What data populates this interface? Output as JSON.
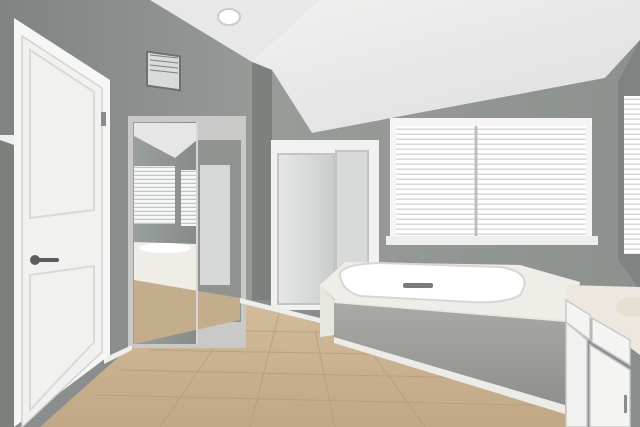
{
  "photo": {
    "subject": "bathroom-interior",
    "palette": {
      "wall": "#8f9491",
      "wall_dark": "#7b807d",
      "ceiling": "#eeeeed",
      "floor": "#c9b394",
      "tub_tile": "#e9e7e1",
      "door": "#f4f4f2",
      "window_light": "#ffffff"
    }
  }
}
